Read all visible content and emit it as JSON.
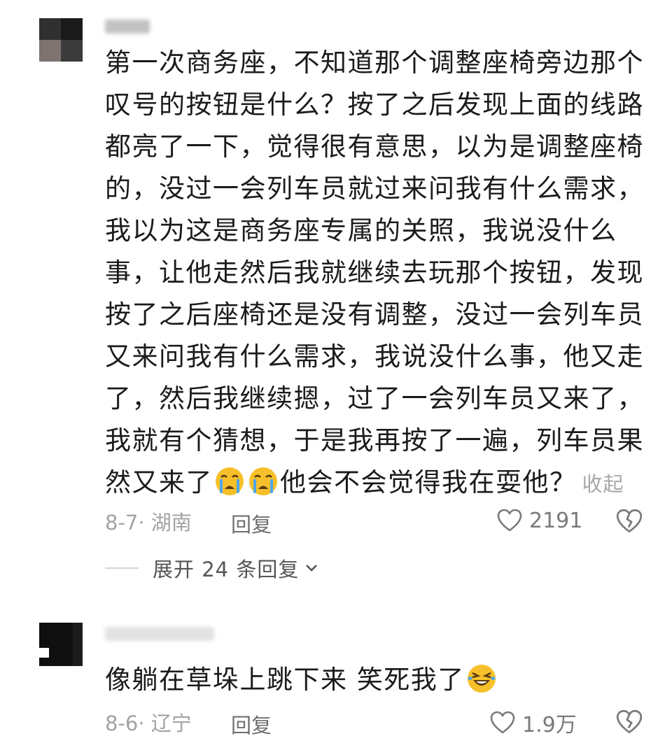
{
  "comments": [
    {
      "author_name": "",
      "text": "第一次商务座，不知道那个调整座椅旁边那个叹号的按钮是什么？按了之后发现上面的线路都亮了一下，觉得很有意思，以为是调整座椅的，没过一会列车员就过来问我有什么需求，我以为这是商务座专属的关照，我说没什么事，让他走然后我就继续去玩那个按钮，发现按了之后座椅还是没有调整，没过一会列车员又来问我有什么需求，我说没什么事，他又走了，然后我继续摁，过了一会列车员又来了，我就有个猜想，于是我再按了一遍，列车员果然又来了",
      "text_after_emoji": "他会不会觉得我在耍他？",
      "emojis": [
        "crying-emoji",
        "crying-emoji"
      ],
      "collapse_label": "收起",
      "date_location": "8-7· 湖南",
      "reply_label": "回复",
      "like_count": "2191",
      "expand_replies_label": "展开 24 条回复"
    },
    {
      "author_name": "",
      "text": "像躺在草垛上跳下来 笑死我了",
      "emojis": [
        "laughing-emoji"
      ],
      "date_location": "8-6· 辽宁",
      "reply_label": "回复",
      "like_count": "1.9万"
    }
  ],
  "icons": {
    "like": "heart-outline-icon",
    "dislike": "broken-heart-icon",
    "expand": "chevron-down-icon"
  },
  "colors": {
    "text": "#1b1b1b",
    "meta": "#a3a3a3",
    "icon": "#7a7a7a",
    "emoji_face": "#f7c02a",
    "emoji_tears": "#4fa7e8"
  }
}
